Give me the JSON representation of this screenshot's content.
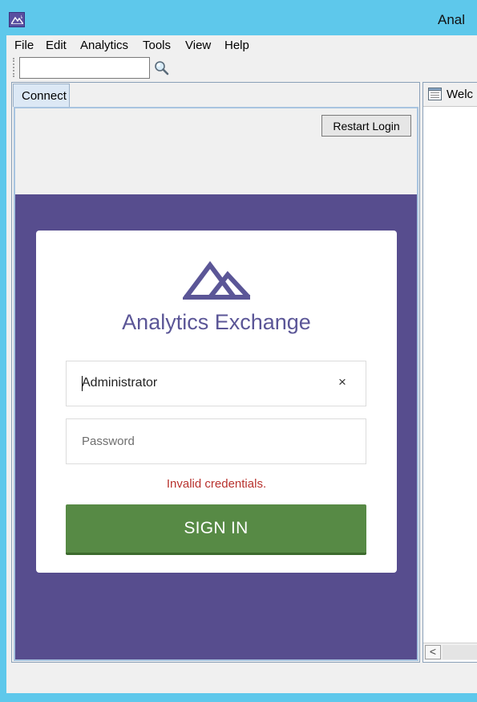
{
  "window": {
    "title": "Anal",
    "titlebar_color": "#5ec8eb",
    "app_icon": "analytics-mountain-icon"
  },
  "menubar": {
    "items": [
      "File",
      "Edit",
      "Analytics",
      "Tools",
      "View",
      "Help"
    ]
  },
  "toolbar": {
    "search_value": "",
    "search_icon": "magnifier-icon"
  },
  "left_panel": {
    "tab_label": "Connect",
    "restart_button_label": "Restart Login",
    "login": {
      "background_color": "#574d8e",
      "brand_name": "Analytics Exchange",
      "username_value": "Administrator",
      "clear_glyph": "×",
      "password_placeholder": "Password",
      "error_message": "Invalid credentials.",
      "signin_label": "SIGN IN",
      "signin_color": "#578a45"
    }
  },
  "right_panel": {
    "tab_label": "Welc",
    "tab_icon": "document-icon",
    "scroll_left_glyph": "<"
  }
}
